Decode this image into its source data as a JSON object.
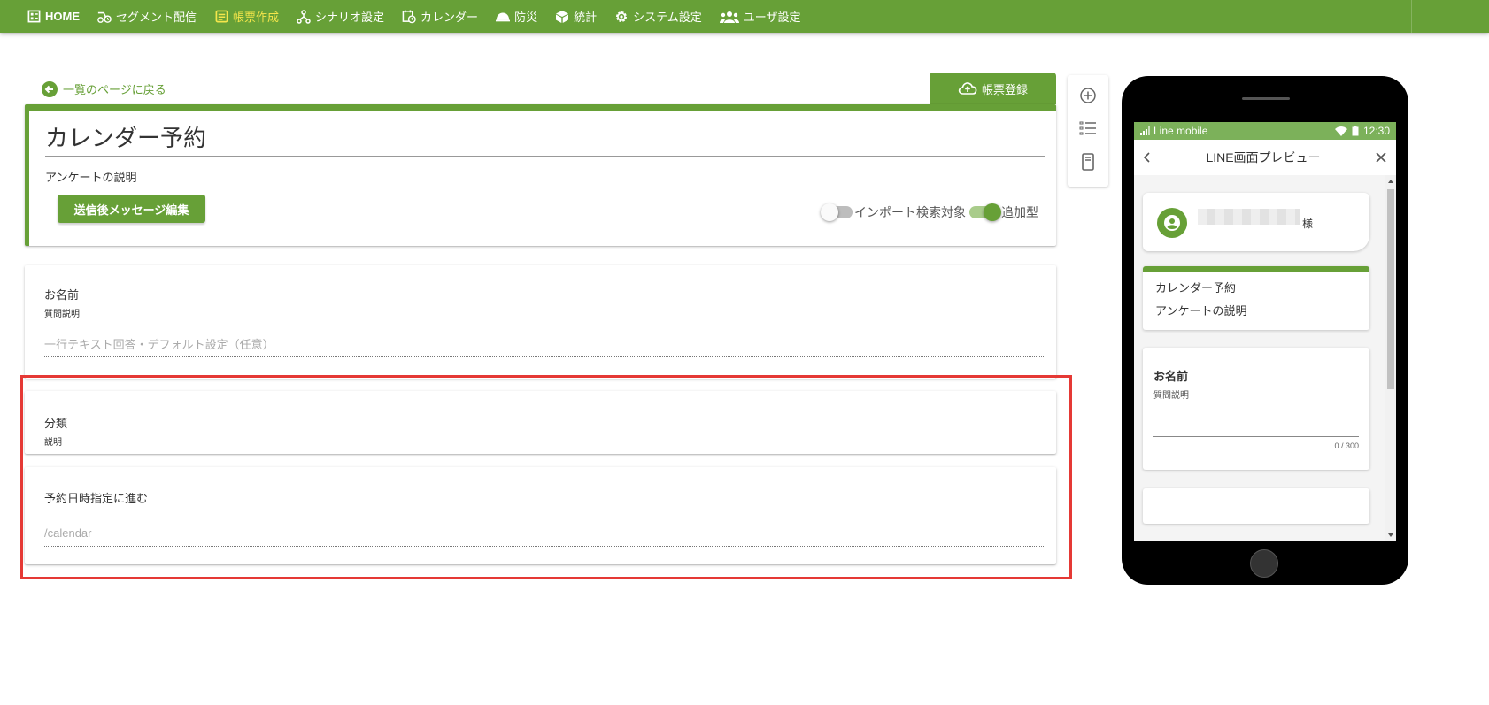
{
  "nav": {
    "items": [
      {
        "label": "HOME",
        "icon": "home-icon"
      },
      {
        "label": "セグメント配信",
        "icon": "segment-icon"
      },
      {
        "label": "帳票作成",
        "icon": "form-icon",
        "active": true
      },
      {
        "label": "シナリオ設定",
        "icon": "scenario-icon"
      },
      {
        "label": "カレンダー",
        "icon": "calendar-icon"
      },
      {
        "label": "防災",
        "icon": "disaster-icon"
      },
      {
        "label": "統計",
        "icon": "stats-icon"
      },
      {
        "label": "システム設定",
        "icon": "gear-icon"
      },
      {
        "label": "ユーザ設定",
        "icon": "users-icon"
      }
    ],
    "bg_color": "#67a037",
    "active_color": "#f5e64b"
  },
  "back_link": {
    "label": "一覧のページに戻る"
  },
  "register_button": {
    "label": "帳票登録"
  },
  "form": {
    "title": "カレンダー予約",
    "description": "アンケートの説明",
    "after_send_button": "送信後メッセージ編集",
    "toggle_import": {
      "label": "インポート検索対象",
      "on": false
    },
    "toggle_append": {
      "label": "追加型",
      "on": true
    }
  },
  "questions": [
    {
      "label": "お名前",
      "sub": "質問説明",
      "placeholder": "一行テキスト回答・デフォルト設定（任意）"
    },
    {
      "label": "分類",
      "sub": "説明"
    },
    {
      "label": "予約日時指定に進む",
      "placeholder": "/calendar"
    }
  ],
  "preview": {
    "status_carrier": "Line mobile",
    "status_time": "12:30",
    "header_title": "LINE画面プレビュー",
    "user_suffix": "様",
    "form_title": "カレンダー予約",
    "form_description": "アンケートの説明",
    "question_label": "お名前",
    "question_sub": "質問説明",
    "counter": "0 / 300"
  }
}
